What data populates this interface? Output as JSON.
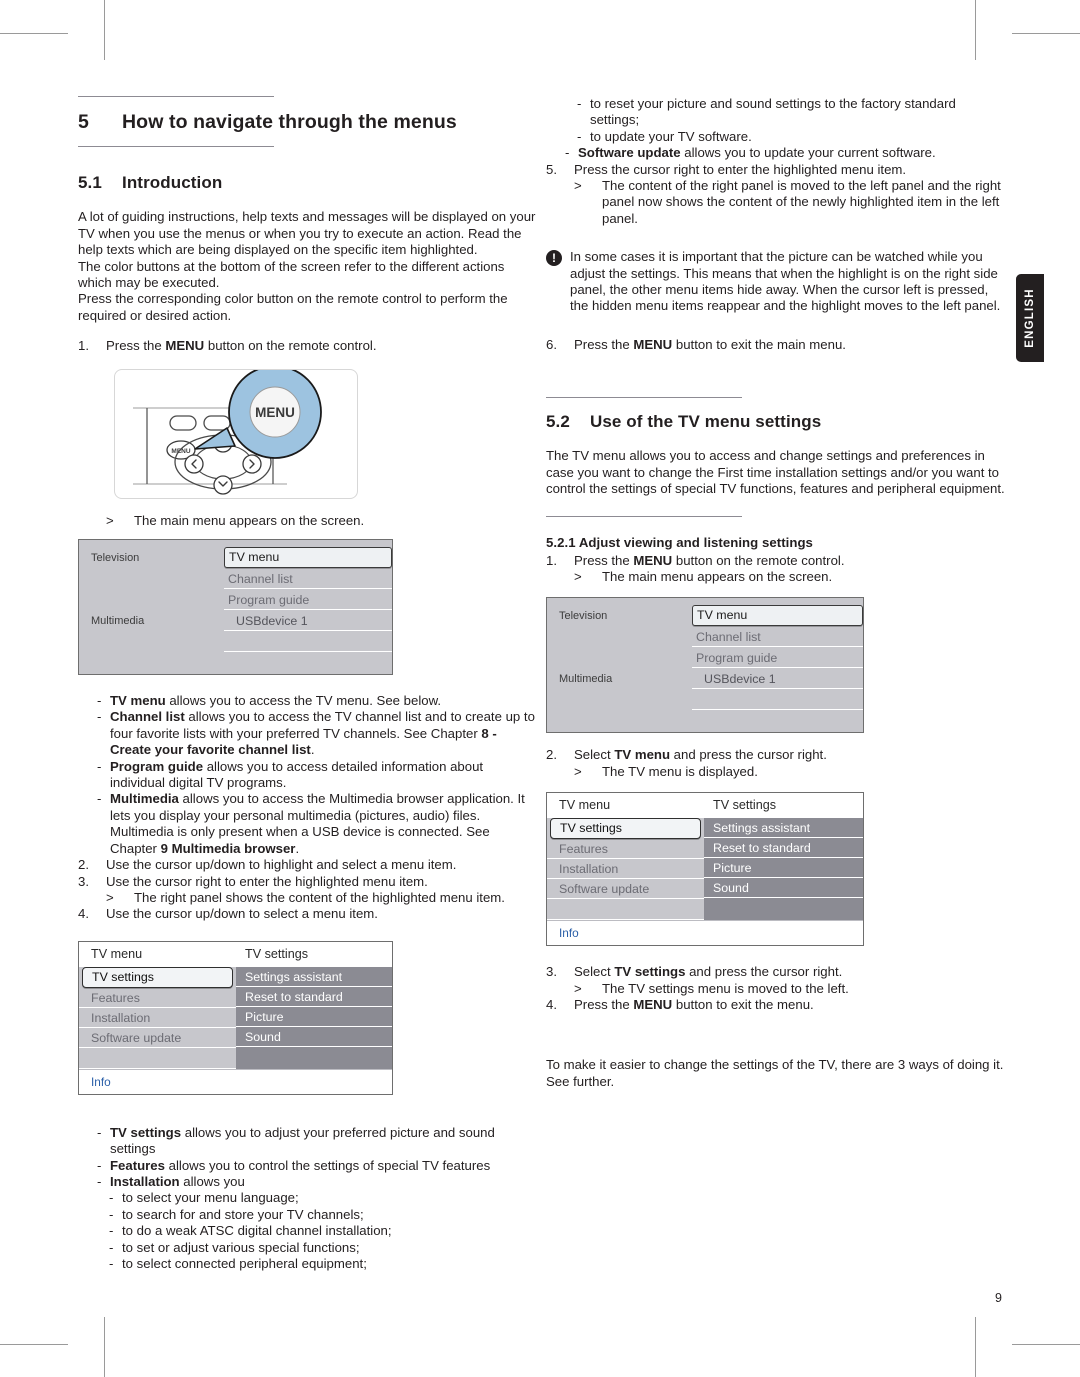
{
  "page": {
    "number": "9",
    "language_tab": "ENGLISH"
  },
  "chapter": {
    "number": "5",
    "title": "How to navigate through the menus"
  },
  "sections": {
    "intro": {
      "number": "5.1",
      "title": "Introduction",
      "paragraph1": "A lot of guiding instructions, help texts and messages will be displayed on your TV when you use the menus or when you try to execute an action. Read the help texts which are being displayed on the specific item highlighted.",
      "paragraph2": "The color buttons at the bottom of the screen refer to the different actions which may be executed.",
      "paragraph3": "Press the corresponding color button on the remote control to perform the required or desired action."
    },
    "tvmenu": {
      "number": "5.2",
      "title": "Use of the TV menu settings",
      "paragraph": "The TV menu allows you to access and change settings and preferences in case you want to change the First time installation settings and/or you want to control the settings of special TV functions, features and peripheral equipment.",
      "sub_number": "5.2.1",
      "sub_title": "Adjust viewing and listening settings"
    }
  },
  "left_column": {
    "step1_marker": "1.",
    "step1_pre": "Press the ",
    "step1_bold": "MENU",
    "step1_post": " button on the remote control.",
    "remote_caption_marker": ">",
    "remote_caption": "The main menu appears on the screen.",
    "bullets_main": [
      {
        "bold": "TV menu",
        "text": " allows you to access the TV menu. See below."
      },
      {
        "bold": "Channel list",
        "text": " allows you to access the TV channel list and to create up to four favorite lists with your preferred TV channels. See Chapter ",
        "bold2": "8 - Create your favorite channel list",
        "text2": "."
      },
      {
        "bold": "Program guide",
        "text": " allows you to access detailed information about individual digital TV programs."
      },
      {
        "bold": "Multimedia",
        "text": " allows you to access the Multimedia browser application. It lets you display your personal multimedia (pictures, audio) files. Multimedia is only present when a USB device is connected. See Chapter ",
        "bold2": "9 Multimedia browser",
        "text2": "."
      }
    ],
    "step2_marker": "2.",
    "step2": "Use the cursor up/down to highlight and select a menu item.",
    "step3_marker": "3.",
    "step3": "Use the cursor right to enter the highlighted menu item.",
    "step3_sub_marker": ">",
    "step3_sub": "The right panel shows the content of the highlighted menu item.",
    "step4_marker": "4.",
    "step4": "Use the cursor up/down to select a menu item.",
    "bullets_settings": [
      {
        "bold": "TV settings",
        "text": " allows you to adjust your preferred picture and sound settings"
      },
      {
        "bold": "Features",
        "text": " allows you to control the settings of special TV features"
      },
      {
        "bold": "Installation",
        "text": " allows you"
      }
    ],
    "installation_sublist": [
      "to select your menu language;",
      "to search for and store your TV channels;",
      "to do a weak ATSC digital channel installation;",
      "to set or adjust various special functions;",
      "to select connected peripheral equipment;"
    ]
  },
  "right_column": {
    "continued_sublist": [
      "to reset your picture and sound settings to the factory standard settings;",
      "to update your TV software."
    ],
    "software_update_bold": "Software update",
    "software_update_text": " allows you to update your current software.",
    "step5_marker": "5.",
    "step5": "Press the cursor right to enter the highlighted menu item.",
    "step5_sub_marker": ">",
    "step5_sub": "The content of the right panel is moved to the left panel and the right panel now shows the content of the newly highlighted item in the left panel.",
    "note_icon": "!",
    "note_text": "In some cases it is important that the picture can be watched while you adjust the settings. This means that when the highlight is on the right side panel, the other menu items hide away. When the cursor left is pressed, the hidden menu items reappear and the highlight moves to the left panel.",
    "step6_marker": "6.",
    "step6_pre": "Press the ",
    "step6_bold": "MENU",
    "step6_post": " button to exit the main menu.",
    "s1_marker": "1.",
    "s1_pre": "Press the ",
    "s1_bold": "MENU",
    "s1_post": " button on the remote control.",
    "s1_sub_marker": ">",
    "s1_sub": "The main menu appears on the screen.",
    "s2_marker": "2.",
    "s2_pre": "Select ",
    "s2_bold": "TV menu",
    "s2_post": " and press the cursor right.",
    "s2_sub_marker": ">",
    "s2_sub": "The TV menu is displayed.",
    "s3_marker": "3.",
    "s3_pre": "Select ",
    "s3_bold": "TV settings",
    "s3_post": " and press the cursor right.",
    "s3_sub_marker": ">",
    "s3_sub": "The TV settings menu is moved to the left.",
    "s4_marker": "4.",
    "s4_pre": "Press the ",
    "s4_bold": "MENU",
    "s4_post": " button to exit the menu.",
    "closing": "To make it easier to change the settings of the TV, there are 3 ways of doing it. See further."
  },
  "main_menu_screen": {
    "group1_label": "Television",
    "group2_label": "Multimedia",
    "items": [
      {
        "label": "TV menu",
        "selected": true
      },
      {
        "label": "Channel list",
        "selected": false
      },
      {
        "label": "Program guide",
        "selected": false
      },
      {
        "label": "USBdevice 1",
        "selected": false
      }
    ]
  },
  "settings_menu_screen": {
    "left_header": "TV menu",
    "right_header": "TV settings",
    "left_items": [
      {
        "label": "TV settings",
        "selected": true
      },
      {
        "label": "Features",
        "selected": false
      },
      {
        "label": "Installation",
        "selected": false
      },
      {
        "label": "Software update",
        "selected": false
      }
    ],
    "right_items": [
      "Settings assistant",
      "Reset to standard",
      "Picture",
      "Sound"
    ],
    "info_label": "Info"
  },
  "remote_figure": {
    "callout_label": "MENU",
    "button_label": "MENU"
  },
  "colors": {
    "menu_bg": "#c7c7cc",
    "menu_panel_dark": "#8b8b93",
    "callout_blue": "#9dc3e0",
    "info_blue": "#2b5fa8",
    "rule": "#8d8b93",
    "text": "#231f20"
  }
}
